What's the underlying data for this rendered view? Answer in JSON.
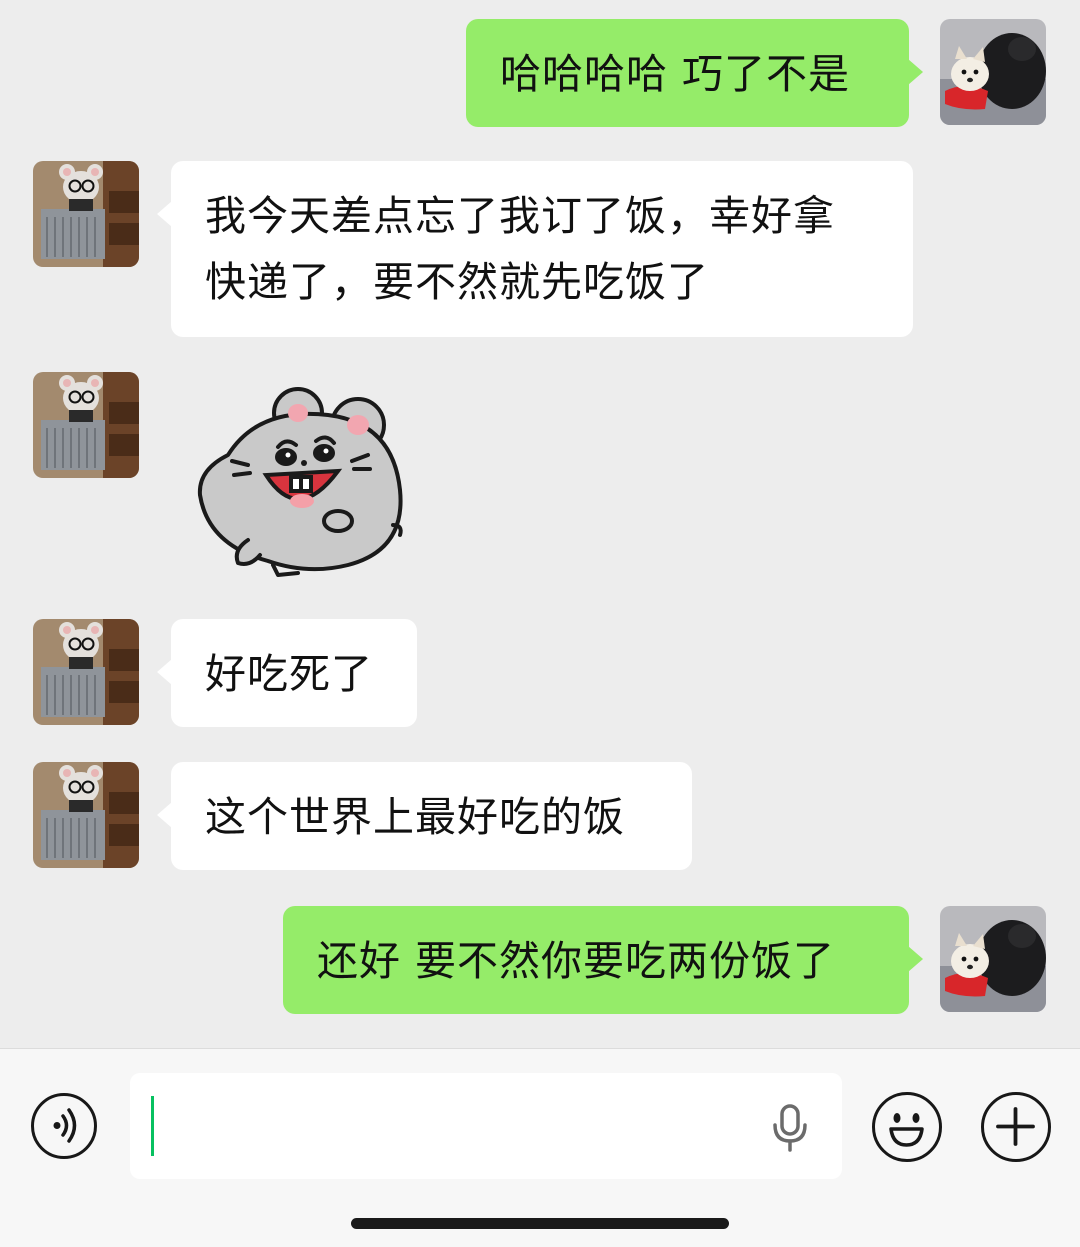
{
  "chat": {
    "messages": [
      {
        "side": "sent",
        "text": "哈哈哈哈 巧了不是"
      },
      {
        "side": "received",
        "lines": [
          "我今天差点忘了我订了饭，幸好拿",
          "快递了，要不然就先吃饭了"
        ]
      },
      {
        "side": "received",
        "sticker": "laughing-gray-mouse-sticker"
      },
      {
        "side": "received",
        "text": "好吃死了"
      },
      {
        "side": "received",
        "text": "这个世界上最好吃的饭"
      },
      {
        "side": "sent",
        "text": "还好 要不然你要吃两份饭了"
      }
    ]
  },
  "input_bar": {
    "value": "",
    "icons": [
      "voice-mode-icon",
      "microphone-icon",
      "emoji-icon",
      "plus-icon"
    ]
  },
  "colors": {
    "background": "#ededed",
    "sent_bubble": "#95ec69",
    "received_bubble": "#ffffff",
    "caret": "#07c160"
  }
}
